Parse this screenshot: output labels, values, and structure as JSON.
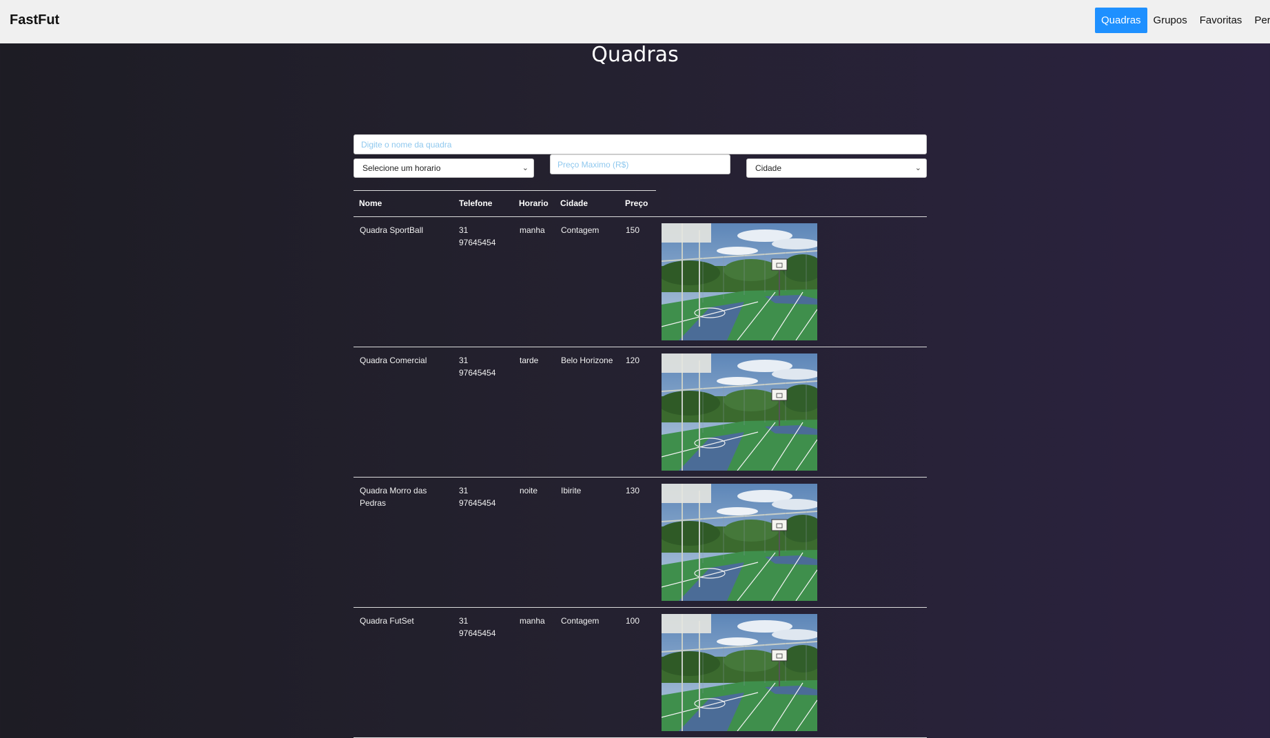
{
  "brand": "FastFut",
  "nav": [
    "Quadras",
    "Grupos",
    "Favoritas",
    "Perfil"
  ],
  "page_title": "Quadras",
  "filters": {
    "name_placeholder": "Digite o nome da quadra",
    "horario_selected": "Selecione um horario",
    "price_placeholder": "Preço Maximo (R$)",
    "cidade_selected": "Cidade"
  },
  "table": {
    "headers": [
      "Nome",
      "Telefone",
      "Horario",
      "Cidade",
      "Preço"
    ],
    "rows": [
      {
        "nome": "Quadra SportBall",
        "telefone": "31 97645454",
        "horario": "manha",
        "cidade": "Contagem",
        "preco": "150"
      },
      {
        "nome": "Quadra Comercial",
        "telefone": "31 97645454",
        "horario": "tarde",
        "cidade": "Belo Horizone",
        "preco": "120"
      },
      {
        "nome": "Quadra Morro das Pedras",
        "telefone": "31 97645454",
        "horario": "noite",
        "cidade": "Ibirite",
        "preco": "130"
      },
      {
        "nome": "Quadra FutSet",
        "telefone": "31 97645454",
        "horario": "manha",
        "cidade": "Contagem",
        "preco": "100"
      }
    ]
  },
  "colors": {
    "active_nav": "#1e90ff",
    "topbar": "#f0f0f0",
    "placeholder": "#8fc8ee"
  }
}
